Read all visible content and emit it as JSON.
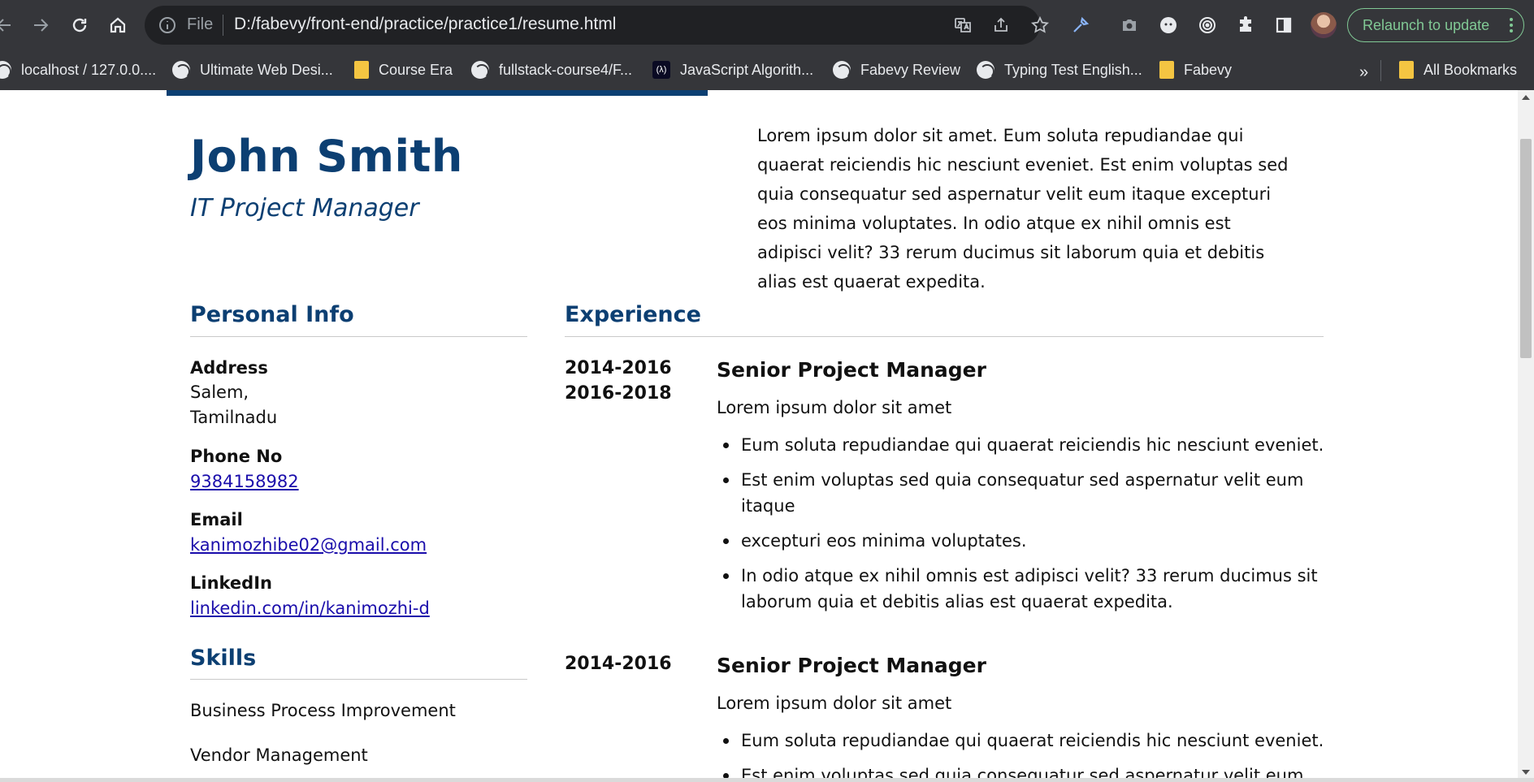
{
  "browser": {
    "url_scheme_label": "File",
    "url": "D:/fabevy/front-end/practice/practice1/resume.html",
    "relaunch_label": "Relaunch to update",
    "bookmarks": [
      {
        "label": "localhost / 127.0.0....",
        "icon": "globe-icon"
      },
      {
        "label": "Ultimate Web Desi...",
        "icon": "globe-icon"
      },
      {
        "label": "Course Era",
        "icon": "folder-icon"
      },
      {
        "label": "fullstack-course4/F...",
        "icon": "globe-icon"
      },
      {
        "label": "JavaScript Algorith...",
        "icon": "freecodecamp-icon"
      },
      {
        "label": "Fabevy Review",
        "icon": "globe-icon"
      },
      {
        "label": "Typing Test English...",
        "icon": "globe-icon"
      },
      {
        "label": "Fabevy",
        "icon": "folder-icon"
      }
    ],
    "more_bookmarks_label": "»",
    "all_bookmarks_label": "All Bookmarks",
    "accent_color": "#81c995"
  },
  "resume": {
    "name": "John Smith",
    "role": "IT Project Manager",
    "summary": "Lorem ipsum dolor sit amet. Eum soluta repudiandae qui quaerat reiciendis hic nesciunt eveniet. Est enim voluptas sed quia consequatur sed aspernatur velit eum itaque excepturi eos minima voluptates. In odio atque ex nihil omnis est adipisci velit? 33 rerum ducimus sit laborum quia et debitis alias est quaerat expedita.",
    "accent_color": "#0c3f72",
    "personal_info": {
      "title": "Personal Info",
      "address_label": "Address",
      "address_line1": "Salem,",
      "address_line2": "Tamilnadu",
      "phone_label": "Phone No",
      "phone": "9384158982",
      "email_label": "Email",
      "email": "kanimozhibe02@gmail.com",
      "linkedin_label": "LinkedIn",
      "linkedin": "linkedin.com/in/kanimozhi-d"
    },
    "skills": {
      "title": "Skills",
      "items": [
        "Business Process Improvement",
        "Vendor Management"
      ]
    },
    "experience": {
      "title": "Experience",
      "jobs": [
        {
          "years": [
            "2014-2016",
            "2016-2018"
          ],
          "title": "Senior Project Manager",
          "subtitle": "Lorem ipsum dolor sit amet",
          "bullets": [
            "Eum soluta repudiandae qui quaerat reiciendis hic nesciunt eveniet.",
            "Est enim voluptas sed quia consequatur sed aspernatur velit eum itaque",
            "excepturi eos minima voluptates.",
            "In odio atque ex nihil omnis est adipisci velit? 33 rerum ducimus sit laborum quia et debitis alias est quaerat expedita."
          ]
        },
        {
          "years": [
            "2014-2016"
          ],
          "title": "Senior Project Manager",
          "subtitle": "Lorem ipsum dolor sit amet",
          "bullets": [
            "Eum soluta repudiandae qui quaerat reiciendis hic nesciunt eveniet.",
            "Est enim voluptas sed quia consequatur sed aspernatur velit eum"
          ]
        }
      ]
    }
  }
}
